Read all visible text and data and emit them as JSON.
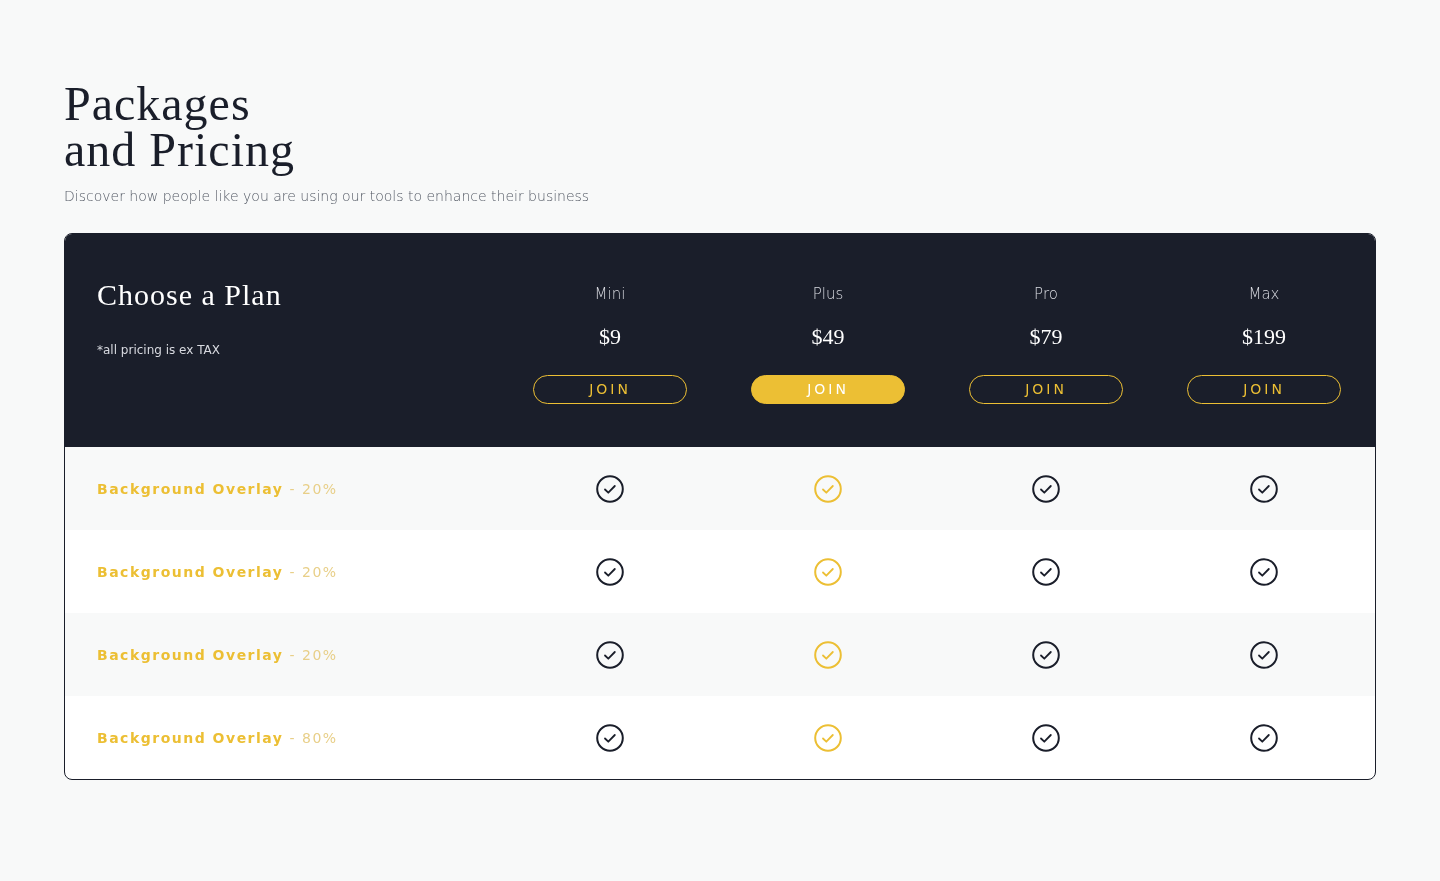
{
  "heading": {
    "title_lines": [
      "Packages",
      "and Pricing"
    ],
    "subtitle": "Discover how people like you are using our tools to enhance their business"
  },
  "table": {
    "title": "Choose a Plan",
    "note": "*all pricing is ex TAX",
    "plans": [
      {
        "name": "Mini",
        "price": "$9",
        "button": "JOIN",
        "featured": false
      },
      {
        "name": "Plus",
        "price": "$49",
        "button": "JOIN",
        "featured": true
      },
      {
        "name": "Pro",
        "price": "$79",
        "button": "JOIN",
        "featured": false
      },
      {
        "name": "Max",
        "price": "$199",
        "button": "JOIN",
        "featured": false
      }
    ],
    "features": [
      {
        "name": "Background Overlay",
        "value": "- 20%",
        "included": [
          true,
          true,
          true,
          true
        ]
      },
      {
        "name": "Background Overlay",
        "value": "- 20%",
        "included": [
          true,
          true,
          true,
          true
        ]
      },
      {
        "name": "Background Overlay",
        "value": "- 20%",
        "included": [
          true,
          true,
          true,
          true
        ]
      },
      {
        "name": "Background Overlay",
        "value": "- 80%",
        "included": [
          true,
          true,
          true,
          true
        ]
      }
    ]
  }
}
